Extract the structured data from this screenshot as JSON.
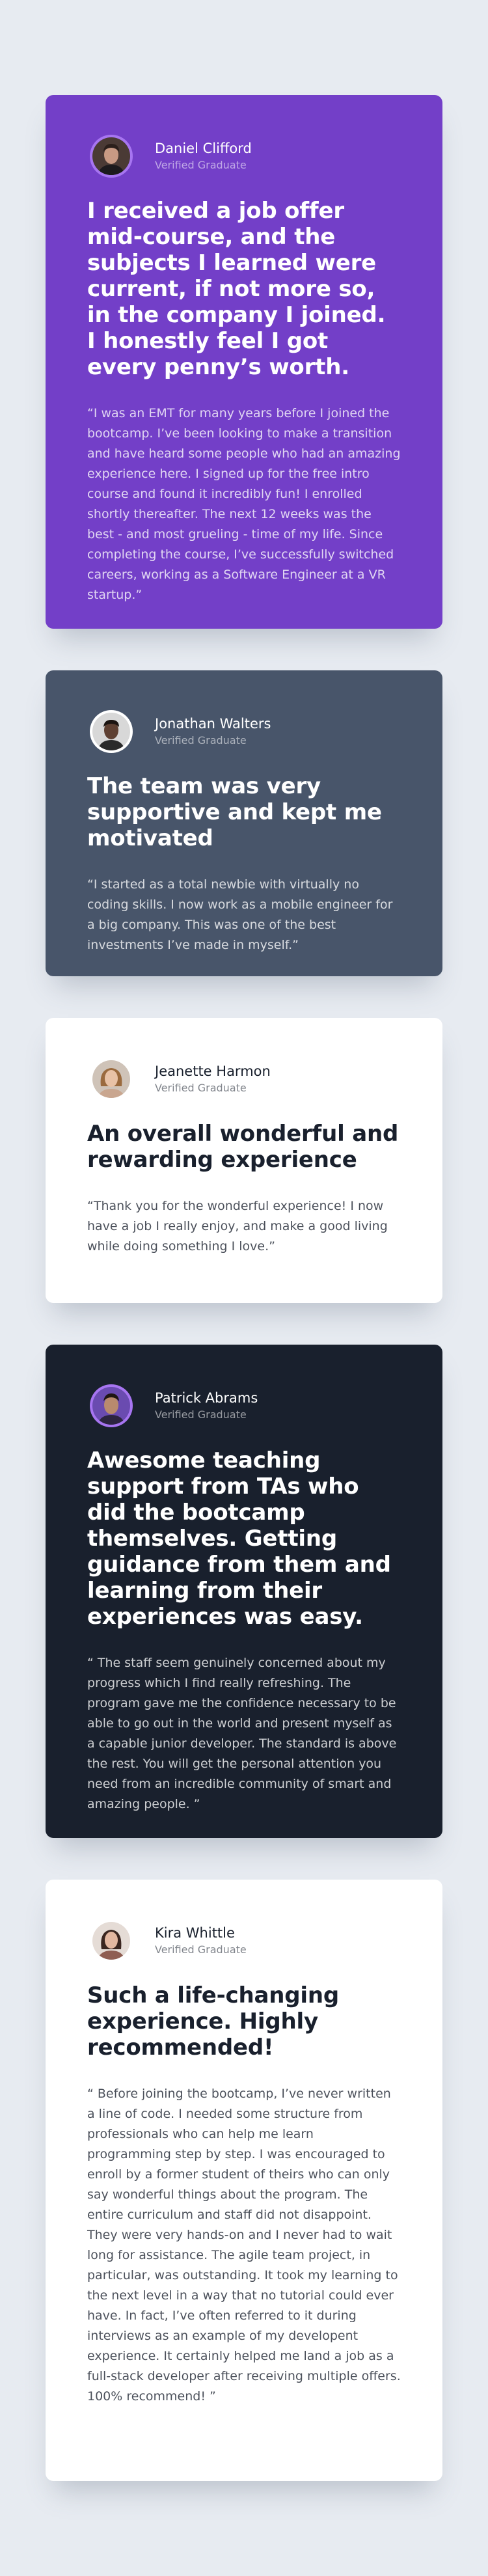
{
  "testimonials": [
    {
      "name": "Daniel Clifford",
      "role": "Verified Graduate",
      "avatar_icon": "daniel-clifford-avatar",
      "theme": "purple",
      "headline": "I received a job offer mid-course, and the subjects I learned were current, if not more so, in the company I joined. I honestly feel I got every penny’s worth.",
      "quote": "“I was an EMT for many years before I joined the bootcamp. I’ve been looking to make a transition and have heard some people who had an amazing experience here. I signed up for the free intro course and found it incredibly fun! I enrolled shortly thereafter. The next 12 weeks was the best - and most grueling - time of my life. Since completing the course, I’ve successfully switched careers, working as a Software Engineer at a VR startup.”"
    },
    {
      "name": "Jonathan Walters",
      "role": "Verified Graduate",
      "avatar_icon": "jonathan-walters-avatar",
      "theme": "slate",
      "headline": "The team was very supportive and kept me motivated",
      "quote": "“I started as a total newbie with virtually no coding skills. I now work as a mobile engineer for a big company. This was one of the best investments I’ve made in myself.”"
    },
    {
      "name": "Jeanette Harmon",
      "role": "Verified Graduate",
      "avatar_icon": "jeanette-harmon-avatar",
      "theme": "white",
      "headline": "An overall wonderful and rewarding experience",
      "quote": "“Thank you for the wonderful experience! I now have a job I really enjoy, and make a good living while doing something I love.”"
    },
    {
      "name": "Patrick Abrams",
      "role": "Verified Graduate",
      "avatar_icon": "patrick-abrams-avatar",
      "theme": "dark",
      "headline": "Awesome teaching support from TAs who did the bootcamp themselves. Getting guidance from them and learning from their experiences was easy.",
      "quote": "“ The staff seem genuinely concerned about my progress which I find really refreshing. The program gave me the confidence necessary to be able to go out in the world and present myself as a capable junior developer. The standard is above the rest. You will get the personal attention you need from an incredible community of smart and amazing people. ”"
    },
    {
      "name": "Kira Whittle",
      "role": "Verified Graduate",
      "avatar_icon": "kira-whittle-avatar",
      "theme": "white",
      "headline": "Such a life-changing experience. Highly recommended!",
      "quote": "“ Before joining the bootcamp, I’ve never written a line of code. I needed some structure from professionals who can help me learn programming step by step. I was encouraged to enroll by a former student of theirs who can only say wonderful things about the program. The entire curriculum and staff did not disappoint. They were very hands-on and I never had to wait long for assistance. The agile team project, in particular, was outstanding. It took my learning to the next level in a way that no tutorial could ever have. In fact, I’ve often referred to it during interviews as an example of my developent experience. It certainly helped me land a job as a full-stack developer after receiving multiple offers. 100% recommend! ”"
    }
  ],
  "colors": {
    "page_bg": "#e7ebf1",
    "purple": "#733fc8",
    "slate": "#48556a",
    "white": "#ffffff",
    "dark": "#19202d",
    "avatar_ring_purple": "#a775f1"
  }
}
